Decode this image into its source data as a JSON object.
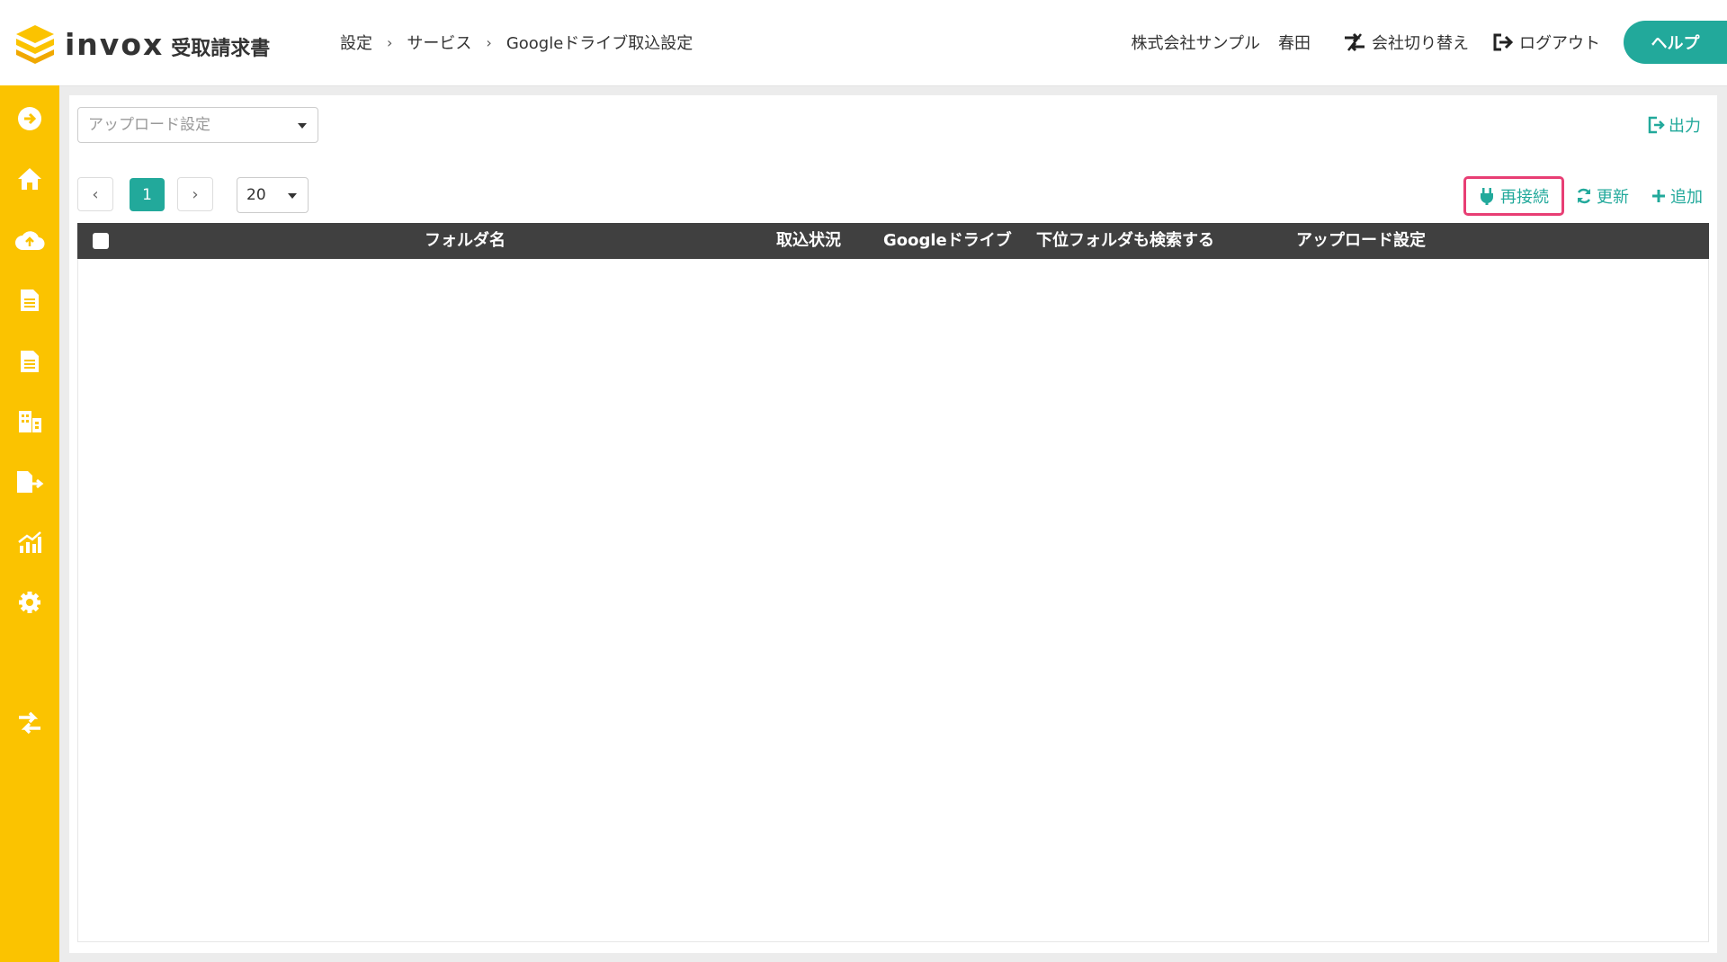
{
  "app": {
    "brand": "invox",
    "product": "受取請求書"
  },
  "breadcrumb": {
    "items": [
      "設定",
      "サービス",
      "Googleドライブ取込設定"
    ],
    "separator": "›"
  },
  "header": {
    "company": "株式会社サンプル",
    "user": "春田",
    "switch_company": "会社切り替え",
    "logout": "ログアウト",
    "help": "ヘルプ"
  },
  "sidebar": {
    "items": [
      "arrow-right-circle-icon",
      "home-icon",
      "cloud-upload-icon",
      "document-icon",
      "document-list-icon",
      "building-icon",
      "file-export-icon",
      "chart-icon",
      "gear-icon",
      "switch-icon"
    ]
  },
  "toolbar": {
    "upload_setting_placeholder": "アップロード設定",
    "export": "出力",
    "page_prev": "‹",
    "page_current": "1",
    "page_next": "›",
    "per_page": "20",
    "reconnect": "再接続",
    "refresh": "更新",
    "add": "追加"
  },
  "table": {
    "columns": [
      "フォルダ名",
      "取込状況",
      "Googleドライブ",
      "下位フォルダも検索する",
      "アップロード設定"
    ],
    "rows": []
  },
  "colors": {
    "accent": "#22a99b",
    "sidebar": "#fbc300",
    "highlight": "#e83e74",
    "table_header": "#404040"
  }
}
